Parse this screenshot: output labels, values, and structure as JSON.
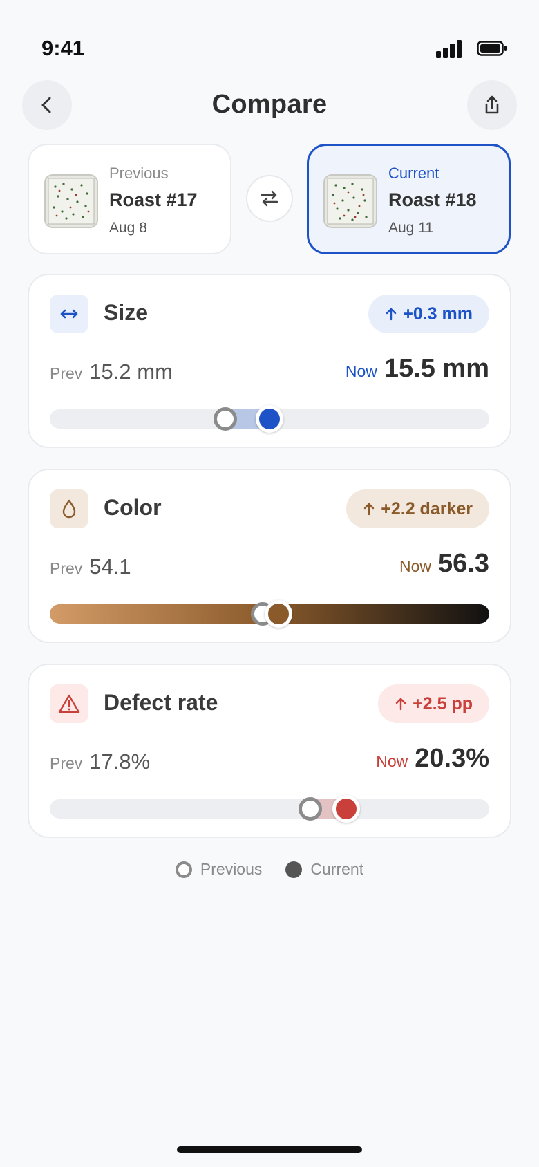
{
  "status": {
    "time": "9:41"
  },
  "header": {
    "title": "Compare"
  },
  "roasts": {
    "previous": {
      "kicker": "Previous",
      "name": "Roast #17",
      "date": "Aug 8"
    },
    "current": {
      "kicker": "Current",
      "name": "Roast #18",
      "date": "Aug 11"
    }
  },
  "metrics": [
    {
      "name": "Size",
      "icon": "horizontal-arrows-icon",
      "delta": "+0.3 mm",
      "prev_label": "Prev",
      "prev_value": "15.2 mm",
      "now_label": "Now",
      "now_value": "15.5 mm",
      "prev_position": 0.4,
      "curr_position": 0.5,
      "accent": "#1d53c6",
      "pill_bg": "#e8effb",
      "icon_bg": "#eaf0fb"
    },
    {
      "name": "Color",
      "icon": "drop-icon",
      "delta": "+2.2 darker",
      "prev_label": "Prev",
      "prev_value": "54.1",
      "now_label": "Now",
      "now_value": "56.3",
      "prev_position": 0.485,
      "curr_position": 0.52,
      "accent": "#8a5a2b",
      "pill_bg": "#f3e8dd",
      "icon_bg": "#f3e8dd",
      "gradient": [
        "#d39b67",
        "#8a5a2b",
        "#111111"
      ]
    },
    {
      "name": "Defect rate",
      "icon": "warning-icon",
      "delta": "+2.5 pp",
      "prev_label": "Prev",
      "prev_value": "17.8%",
      "now_label": "Now",
      "now_value": "20.3%",
      "prev_position": 0.592,
      "curr_position": 0.675,
      "accent": "#c9403a",
      "pill_bg": "#fce9e8",
      "icon_bg": "#fce9e8"
    }
  ],
  "legend": {
    "previous": "Previous",
    "current": "Current"
  }
}
